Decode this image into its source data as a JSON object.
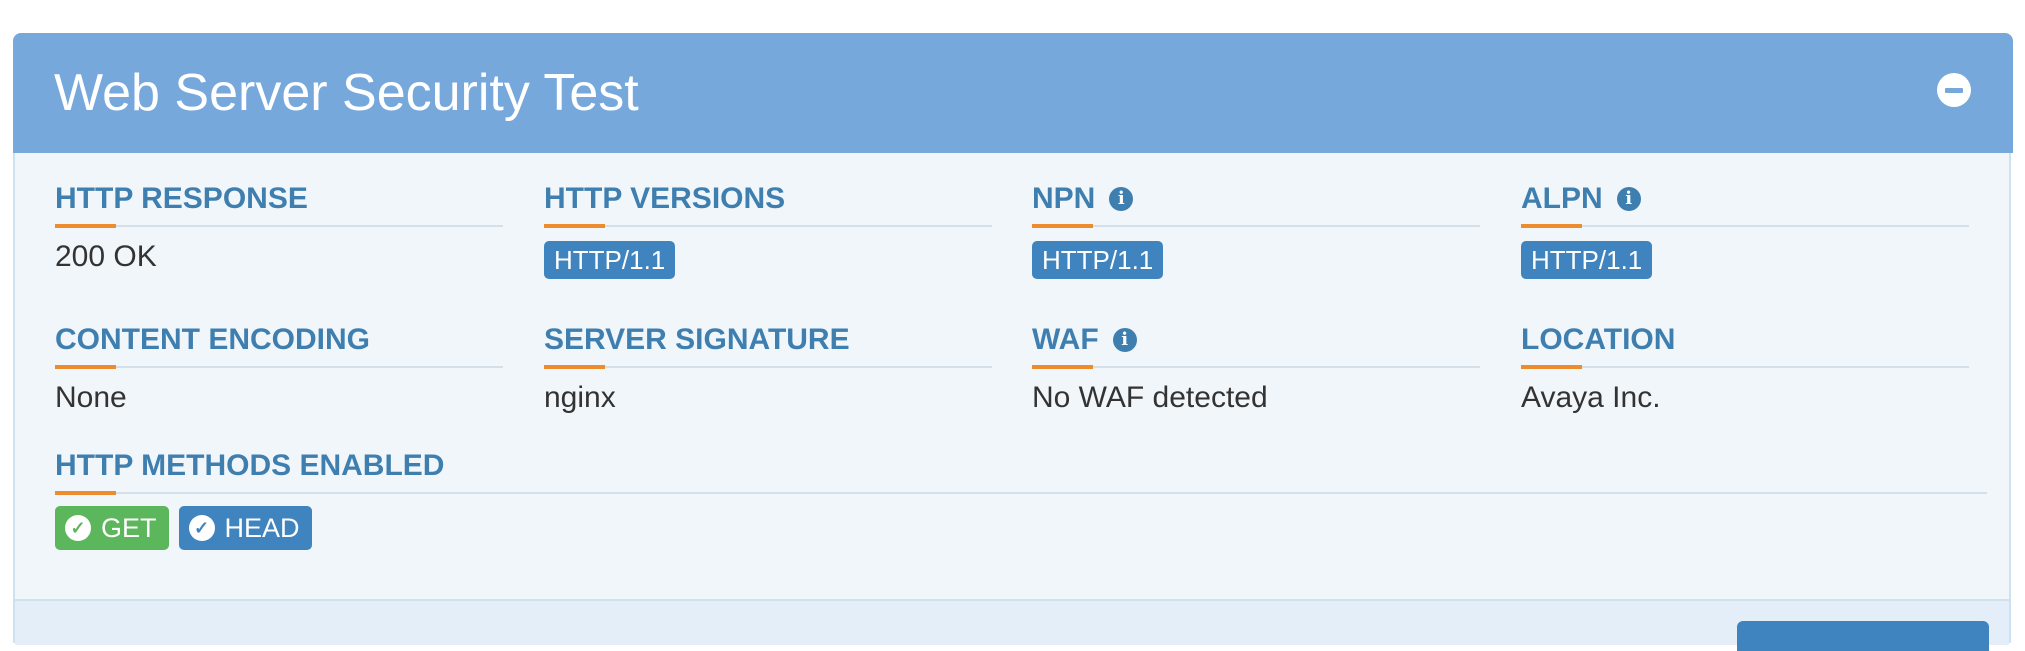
{
  "panel": {
    "title": "Web Server Security Test"
  },
  "fields": {
    "http_response": {
      "label": "HTTP RESPONSE",
      "value": "200 OK"
    },
    "http_versions": {
      "label": "HTTP VERSIONS",
      "badge": "HTTP/1.1"
    },
    "npn": {
      "label": "NPN",
      "badge": "HTTP/1.1",
      "icon": "info-icon"
    },
    "alpn": {
      "label": "ALPN",
      "badge": "HTTP/1.1",
      "icon": "info-icon"
    },
    "content_encoding": {
      "label": "CONTENT ENCODING",
      "value": "None"
    },
    "server_signature": {
      "label": "SERVER SIGNATURE",
      "value": "nginx"
    },
    "waf": {
      "label": "WAF",
      "value": "No WAF detected",
      "icon": "info-icon"
    },
    "location": {
      "label": "LOCATION",
      "value": "Avaya Inc."
    },
    "http_methods": {
      "label": "HTTP METHODS ENABLED",
      "methods": [
        {
          "label": "GET",
          "color": "#5cb65c",
          "icon": "check-circle-icon"
        },
        {
          "label": "HEAD",
          "color": "#3f84bf",
          "icon": "check-circle-icon"
        }
      ]
    }
  },
  "colors": {
    "header": "#76a8dc",
    "label": "#3f7fb0",
    "accent": "#ec8c2c",
    "badge": "#3f84bf"
  }
}
